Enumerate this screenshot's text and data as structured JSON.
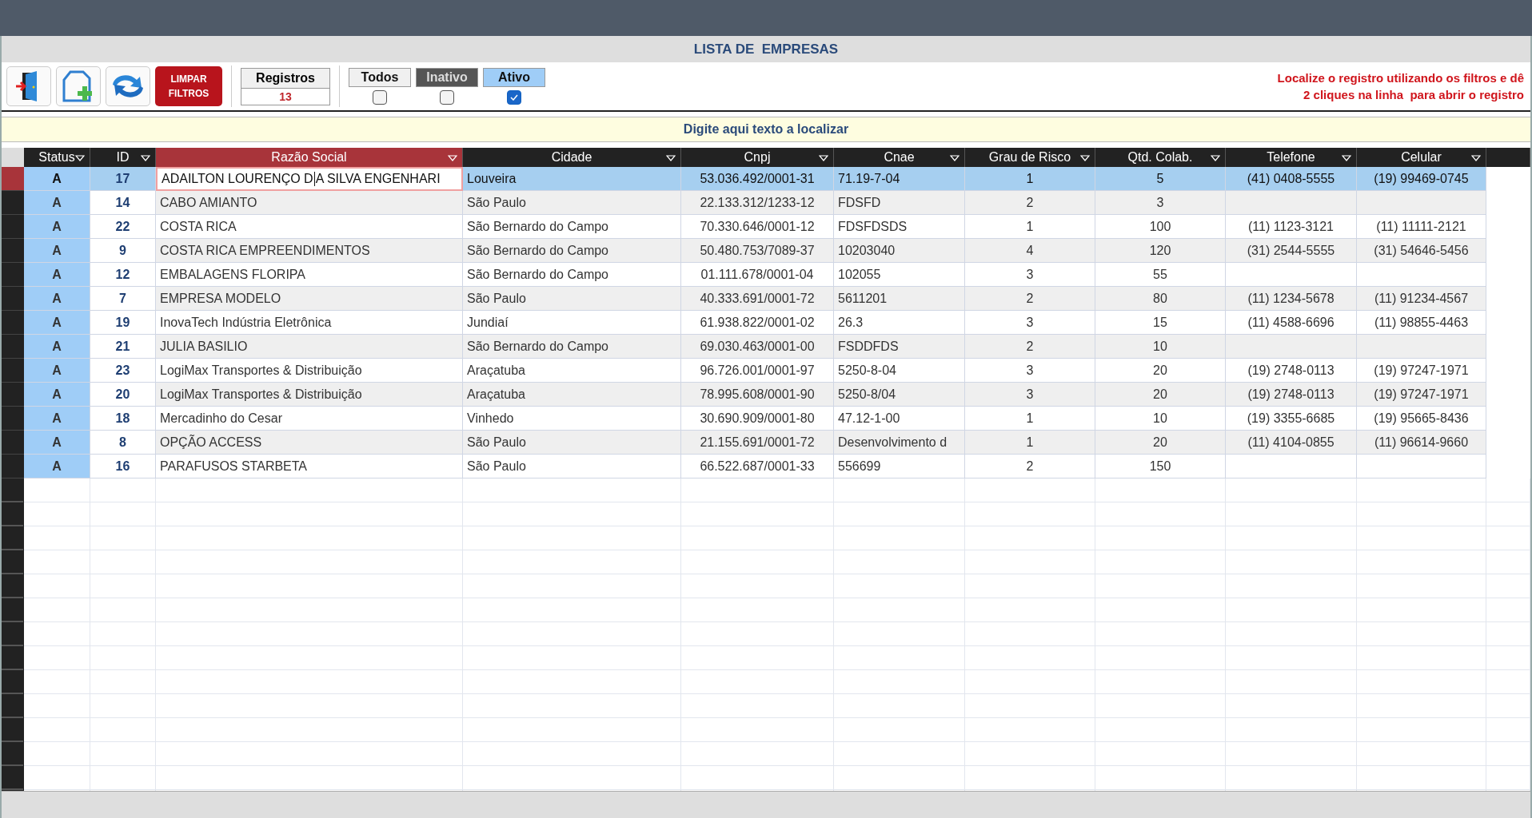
{
  "window": {
    "title": "LISTA DE  EMPRESAS"
  },
  "toolbar": {
    "clear_button": "LIMPAR FILTROS",
    "records": {
      "label": "Registros",
      "count": "13"
    },
    "filters": [
      {
        "label": "Todos",
        "kind": "neutral",
        "checked": false
      },
      {
        "label": "Inativo",
        "kind": "inactive",
        "checked": false
      },
      {
        "label": "Ativo",
        "kind": "active",
        "checked": true
      }
    ],
    "hint": [
      "Localize o registro utilizando os filtros e dê",
      "2 cliques na linha  para abrir o registro"
    ]
  },
  "search": {
    "placeholder": "Digite aqui texto a localizar"
  },
  "table": {
    "columns": [
      {
        "label": "Status",
        "sorted": false
      },
      {
        "label": "ID",
        "sorted": false
      },
      {
        "label": "Razão Social",
        "sorted": true
      },
      {
        "label": "Cidade",
        "sorted": false
      },
      {
        "label": "Cnpj",
        "sorted": false
      },
      {
        "label": "Cnae",
        "sorted": false
      },
      {
        "label": "Grau de Risco",
        "sorted": false
      },
      {
        "label": "Qtd. Colab.",
        "sorted": false
      },
      {
        "label": "Telefone",
        "sorted": false
      },
      {
        "label": "Celular",
        "sorted": false
      }
    ],
    "rows": [
      {
        "selected": true,
        "editing": true,
        "cells": [
          "A",
          "17",
          "ADAILTON LOURENÇO DA SILVA ENGENHARI",
          "Louveira",
          "53.036.492/0001-31",
          "71.19-7-04",
          "1",
          "5",
          "(41) 0408-5555",
          "(19) 99469-0745"
        ]
      },
      {
        "selected": false,
        "editing": false,
        "cells": [
          "A",
          "14",
          "CABO AMIANTO",
          "São Paulo",
          "22.133.312/1233-12",
          "FDSFD",
          "2",
          "3",
          "",
          ""
        ]
      },
      {
        "selected": false,
        "editing": false,
        "cells": [
          "A",
          "22",
          "COSTA RICA",
          "São Bernardo do Campo",
          "70.330.646/0001-12",
          "FDSFDSDS",
          "1",
          "100",
          "(11) 1123-3121",
          "(11) 11111-2121"
        ]
      },
      {
        "selected": false,
        "editing": false,
        "cells": [
          "A",
          "9",
          "COSTA RICA EMPREENDIMENTOS",
          "São Bernardo do Campo",
          "50.480.753/7089-37",
          "10203040",
          "4",
          "120",
          "(31) 2544-5555",
          "(31) 54646-5456"
        ]
      },
      {
        "selected": false,
        "editing": false,
        "cells": [
          "A",
          "12",
          "EMBALAGENS FLORIPA",
          "São Bernardo do Campo",
          "01.111.678/0001-04",
          "102055",
          "3",
          "55",
          "",
          ""
        ]
      },
      {
        "selected": false,
        "editing": false,
        "cells": [
          "A",
          "7",
          "EMPRESA MODELO",
          "São Paulo",
          "40.333.691/0001-72",
          "5611201",
          "2",
          "80",
          "(11) 1234-5678",
          "(11) 91234-4567"
        ]
      },
      {
        "selected": false,
        "editing": false,
        "cells": [
          "A",
          "19",
          "InovaTech Indústria Eletrônica",
          "Jundiaí",
          "61.938.822/0001-02",
          "26.3",
          "3",
          "15",
          "(11) 4588-6696",
          "(11) 98855-4463"
        ]
      },
      {
        "selected": false,
        "editing": false,
        "cells": [
          "A",
          "21",
          "JULIA BASILIO",
          "São Bernardo do Campo",
          "69.030.463/0001-00",
          "FSDDFDS",
          "2",
          "10",
          "",
          ""
        ]
      },
      {
        "selected": false,
        "editing": false,
        "cells": [
          "A",
          "23",
          "LogiMax Transportes & Distribuição",
          "Araçatuba",
          "96.726.001/0001-97",
          "5250-8-04",
          "3",
          "20",
          "(19) 2748-0113",
          "(19) 97247-1971"
        ]
      },
      {
        "selected": false,
        "editing": false,
        "cells": [
          "A",
          "20",
          "LogiMax Transportes & Distribuição",
          "Araçatuba",
          "78.995.608/0001-90",
          "5250-8/04",
          "3",
          "20",
          "(19) 2748-0113",
          "(19) 97247-1971"
        ]
      },
      {
        "selected": false,
        "editing": false,
        "cells": [
          "A",
          "18",
          "Mercadinho do Cesar",
          "Vinhedo",
          "30.690.909/0001-80",
          "47.12-1-00",
          "1",
          "10",
          "(19) 3355-6685",
          "(19) 95665-8436"
        ]
      },
      {
        "selected": false,
        "editing": false,
        "cells": [
          "A",
          "8",
          "OPÇÃO ACCESS",
          "São Paulo",
          "21.155.691/0001-72",
          "Desenvolvimento d",
          "1",
          "20",
          "(11) 4104-0855",
          "(11) 96614-9660"
        ]
      },
      {
        "selected": false,
        "editing": false,
        "cells": [
          "A",
          "16",
          "PARAFUSOS STARBETA",
          "São Paulo",
          "66.522.687/0001-33",
          "556699",
          "2",
          "150",
          "",
          ""
        ]
      }
    ]
  }
}
